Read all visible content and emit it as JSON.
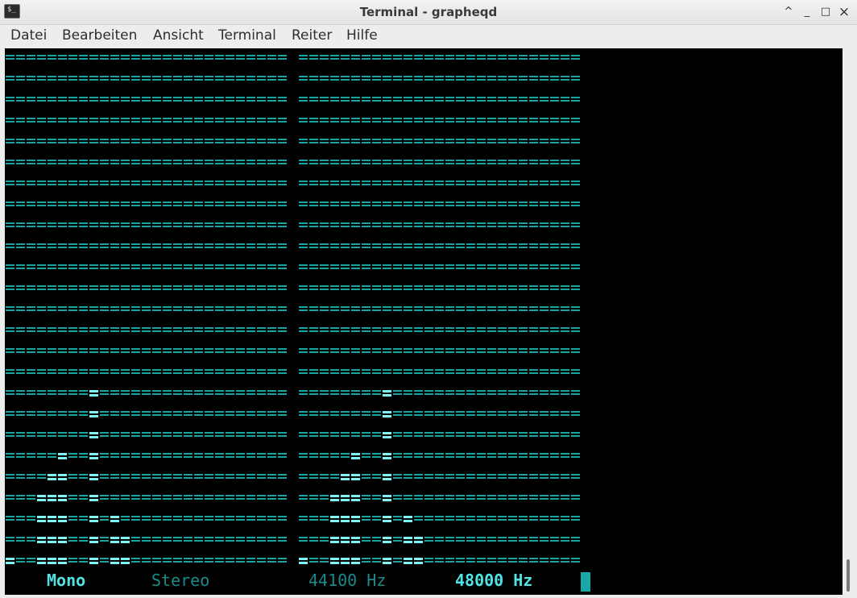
{
  "window": {
    "title": "Terminal - grapheqd",
    "app_icon_glyph": "$_",
    "controls": {
      "shade": "^",
      "minimize": "_",
      "maximize": "□",
      "close": "×"
    }
  },
  "menu": [
    "Datei",
    "Bearbeiten",
    "Ansicht",
    "Terminal",
    "Reiter",
    "Hilfe"
  ],
  "equalizer": {
    "rows": 25,
    "bands_per_channel": 27,
    "channels": 2,
    "channel_levels": [
      [
        1,
        0,
        0,
        4,
        5,
        6,
        0,
        0,
        9,
        0,
        3,
        2,
        0,
        0,
        0,
        0,
        0,
        0,
        0,
        0,
        0,
        0,
        0,
        0,
        0,
        0,
        0
      ],
      [
        1,
        0,
        0,
        4,
        5,
        6,
        0,
        0,
        9,
        0,
        3,
        2,
        0,
        0,
        0,
        0,
        0,
        0,
        0,
        0,
        0,
        0,
        0,
        0,
        0,
        0,
        0
      ]
    ],
    "bar_char": "=",
    "colors": {
      "background": "#000000",
      "grid": "#1aa5a5",
      "level": "#7ff7f7"
    }
  },
  "status": {
    "mono": "Mono",
    "stereo": "Stereo",
    "rate_low": "44100 Hz",
    "rate_high": "48000 Hz",
    "active_channel_mode": "Mono",
    "active_rate": "48000 Hz"
  }
}
